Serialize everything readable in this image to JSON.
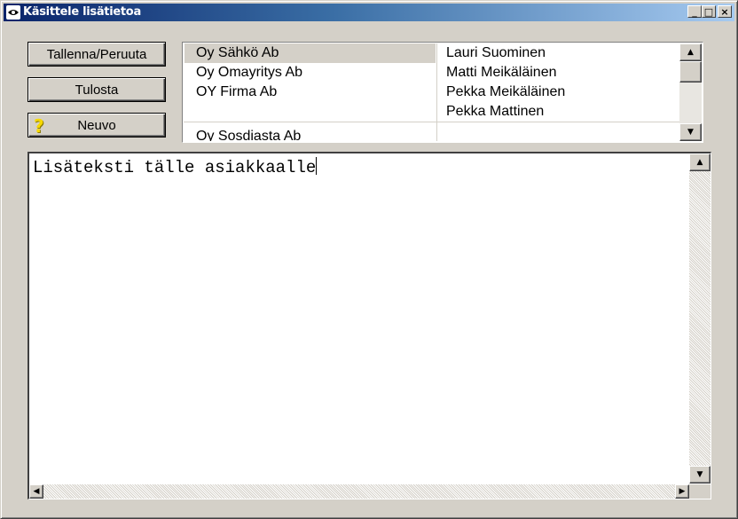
{
  "window": {
    "title": "Käsittele lisätietoa",
    "app_icon": "eye-icon",
    "controls": {
      "minimize": "_",
      "maximize": "□",
      "close": "×"
    }
  },
  "buttons": {
    "save_cancel": "Tallenna/Peruuta",
    "print": "Tulosta",
    "help": "Neuvo",
    "help_icon": "?"
  },
  "list": {
    "rows": [
      {
        "company": "Oy Sähkö Ab",
        "person": "Lauri Suominen",
        "selected": true
      },
      {
        "company": "Oy Omayritys Ab",
        "person": "Matti Meikäläinen",
        "selected": false
      },
      {
        "company": "OY Firma Ab",
        "person": "Pekka Meikäläinen",
        "selected": false
      },
      {
        "company": "",
        "person": "Pekka Mattinen",
        "selected": false
      },
      {
        "company": "Oy Sosdiasta Ab",
        "person": "",
        "selected": false
      }
    ]
  },
  "editor": {
    "text": "Lisäteksti tälle asiakkaalle"
  },
  "scroll": {
    "up": "▲",
    "down": "▼",
    "left": "◀",
    "right": "▶"
  },
  "colors": {
    "face": "#d4d0c8",
    "title_start": "#0a246a",
    "title_end": "#a6caf0",
    "selection": "#d4d0c8"
  }
}
